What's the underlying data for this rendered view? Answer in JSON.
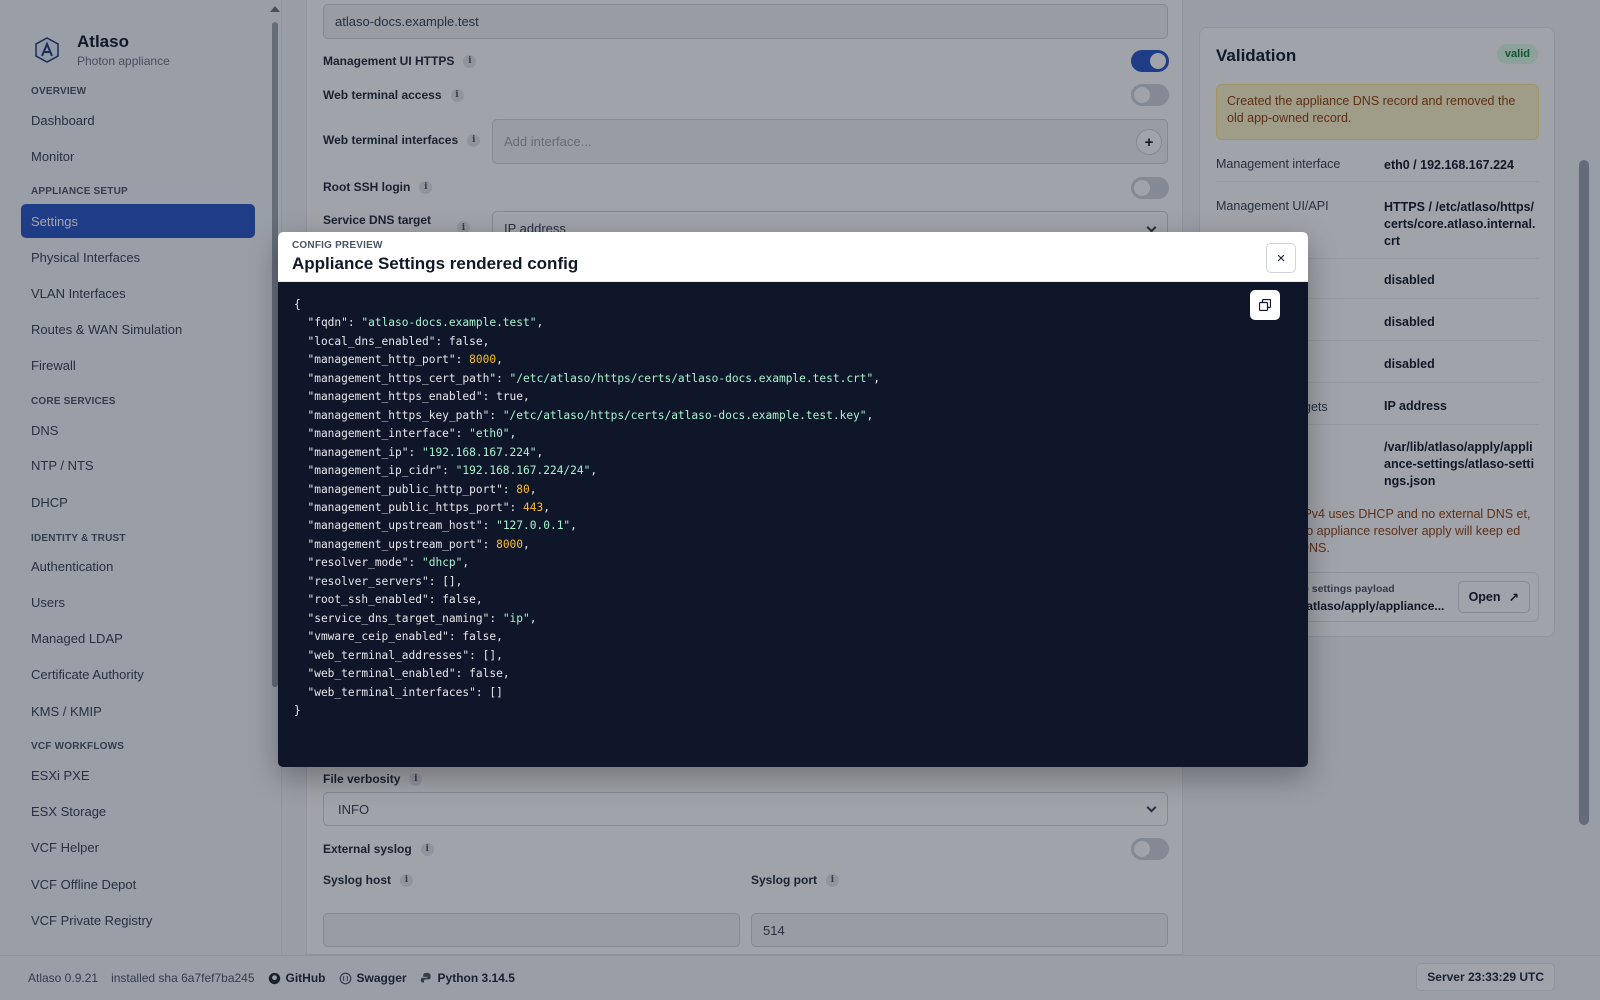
{
  "brand": {
    "name": "Atlaso",
    "subtitle": "Photon appliance"
  },
  "sidebar": {
    "sections": [
      {
        "title": "OVERVIEW",
        "items": [
          {
            "label": "Dashboard"
          },
          {
            "label": "Monitor"
          }
        ]
      },
      {
        "title": "APPLIANCE SETUP",
        "items": [
          {
            "label": "Settings",
            "active": true
          },
          {
            "label": "Physical Interfaces"
          },
          {
            "label": "VLAN Interfaces"
          },
          {
            "label": "Routes & WAN Simulation"
          },
          {
            "label": "Firewall"
          }
        ]
      },
      {
        "title": "CORE SERVICES",
        "items": [
          {
            "label": "DNS"
          },
          {
            "label": "NTP / NTS"
          },
          {
            "label": "DHCP"
          }
        ]
      },
      {
        "title": "IDENTITY & TRUST",
        "items": [
          {
            "label": "Authentication"
          },
          {
            "label": "Users"
          },
          {
            "label": "Managed LDAP"
          },
          {
            "label": "Certificate Authority"
          },
          {
            "label": "KMS / KMIP"
          }
        ]
      },
      {
        "title": "VCF WORKFLOWS",
        "items": [
          {
            "label": "ESXi PXE"
          },
          {
            "label": "ESX Storage"
          },
          {
            "label": "VCF Helper"
          },
          {
            "label": "VCF Offline Depot"
          },
          {
            "label": "VCF Private Registry"
          }
        ]
      }
    ]
  },
  "form": {
    "fqdn_value": "atlaso-docs.example.test",
    "mgmt_https_label": "Management UI HTTPS",
    "mgmt_https_on": true,
    "web_terminal_label": "Web terminal access",
    "web_terminal_on": false,
    "web_terminal_ifaces_label": "Web terminal interfaces",
    "web_terminal_ifaces_placeholder": "Add interface...",
    "add_symbol": "+",
    "root_ssh_label": "Root SSH login",
    "root_ssh_on": false,
    "service_dns_label": "Service DNS target",
    "service_dns_value": "IP address",
    "file_verbosity_label": "File verbosity",
    "file_verbosity_value": "INFO",
    "external_syslog_label": "External syslog",
    "external_syslog_on": false,
    "syslog_host_label": "Syslog host",
    "syslog_host_value": "",
    "syslog_port_label": "Syslog port",
    "syslog_port_value": "514",
    "info_glyph": "i"
  },
  "validation": {
    "title": "Validation",
    "badge": "valid",
    "alert": "Created the appliance DNS record and removed the old app-owned record.",
    "rows": [
      {
        "key": "Management interface",
        "value": "eth0 / 192.168.167.224"
      },
      {
        "key": "Management UI/API",
        "value": "HTTPS / /etc/atlaso/https/certs/core.atlaso.internal.crt"
      },
      {
        "key": "",
        "value": "disabled"
      },
      {
        "key": "",
        "value": "disabled"
      },
      {
        "key": "",
        "value": "disabled"
      },
      {
        "key": "gets",
        "value": "IP address"
      },
      {
        "key": "",
        "value": "/var/lib/atlaso/apply/appliance-settings/atlaso-settings.json"
      }
    ],
    "note": "IPv4 uses DHCP and no external DNS et, so appliance resolver apply will keep ed DNS.",
    "payload_label": "e settings payload",
    "payload_path": "/atlaso/apply/appliance...",
    "open_label": "Open",
    "open_icon": "↗"
  },
  "modal": {
    "kicker": "CONFIG PREVIEW",
    "title": "Appliance Settings rendered config",
    "close_symbol": "×",
    "config": [
      {
        "key": "fqdn",
        "value": "\"atlaso-docs.example.test\"",
        "type": "string"
      },
      {
        "key": "local_dns_enabled",
        "value": "false",
        "type": "bool"
      },
      {
        "key": "management_http_port",
        "value": "8000",
        "type": "number"
      },
      {
        "key": "management_https_cert_path",
        "value": "\"/etc/atlaso/https/certs/atlaso-docs.example.test.crt\"",
        "type": "string"
      },
      {
        "key": "management_https_enabled",
        "value": "true",
        "type": "bool"
      },
      {
        "key": "management_https_key_path",
        "value": "\"/etc/atlaso/https/certs/atlaso-docs.example.test.key\"",
        "type": "string"
      },
      {
        "key": "management_interface",
        "value": "\"eth0\"",
        "type": "string"
      },
      {
        "key": "management_ip",
        "value": "\"192.168.167.224\"",
        "type": "string"
      },
      {
        "key": "management_ip_cidr",
        "value": "\"192.168.167.224/24\"",
        "type": "string"
      },
      {
        "key": "management_public_http_port",
        "value": "80",
        "type": "number"
      },
      {
        "key": "management_public_https_port",
        "value": "443",
        "type": "number"
      },
      {
        "key": "management_upstream_host",
        "value": "\"127.0.0.1\"",
        "type": "string"
      },
      {
        "key": "management_upstream_port",
        "value": "8000",
        "type": "number"
      },
      {
        "key": "resolver_mode",
        "value": "\"dhcp\"",
        "type": "string"
      },
      {
        "key": "resolver_servers",
        "value": "[]",
        "type": "array"
      },
      {
        "key": "root_ssh_enabled",
        "value": "false",
        "type": "bool"
      },
      {
        "key": "service_dns_target_naming",
        "value": "\"ip\"",
        "type": "string"
      },
      {
        "key": "vmware_ceip_enabled",
        "value": "false",
        "type": "bool"
      },
      {
        "key": "web_terminal_addresses",
        "value": "[]",
        "type": "array"
      },
      {
        "key": "web_terminal_enabled",
        "value": "false",
        "type": "bool"
      },
      {
        "key": "web_terminal_interfaces",
        "value": "[]",
        "type": "array"
      }
    ]
  },
  "footer": {
    "version": "Atlaso 0.9.21",
    "sha": "installed sha 6a7fef7ba245",
    "github": "GitHub",
    "swagger": "Swagger",
    "python": "Python 3.14.5",
    "server_time": "Server 23:33:29 UTC"
  },
  "colors": {
    "accent": "#2856c6",
    "code_bg": "#0f1629",
    "string": "#a7f3d0",
    "number": "#fbbf24",
    "valid": "#15803d",
    "warning": "#92400e"
  }
}
